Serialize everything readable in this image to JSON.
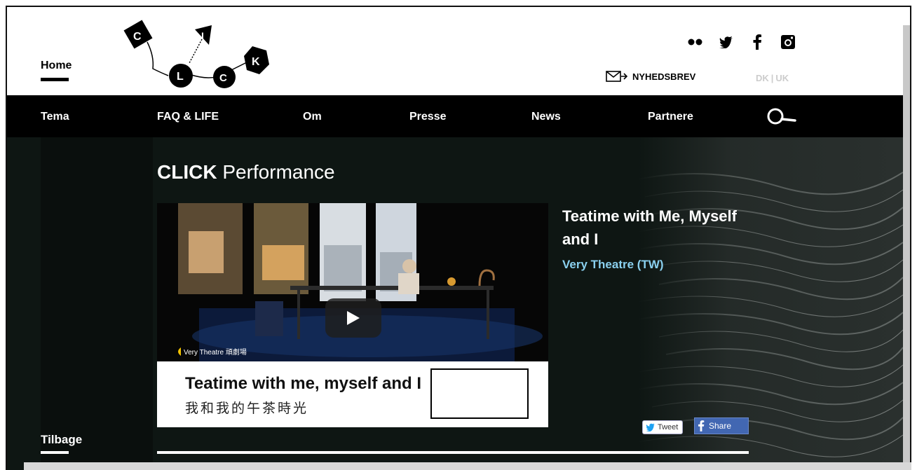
{
  "header": {
    "home_label": "Home",
    "logo_letters": [
      "C",
      "L",
      "I",
      "C",
      "K"
    ],
    "social_icons": [
      "flickr-icon",
      "twitter-icon",
      "facebook-icon",
      "instagram-icon"
    ],
    "newsletter_label": "NYHEDSBREV",
    "lang_dk": "DK",
    "lang_sep": "|",
    "lang_uk": "UK"
  },
  "nav": {
    "items": [
      {
        "label": "Tema",
        "name": "nav-item-tema"
      },
      {
        "label": "FAQ & LIFE",
        "name": "nav-item-faq-life"
      },
      {
        "label": "Om",
        "name": "nav-item-om"
      },
      {
        "label": "Presse",
        "name": "nav-item-presse"
      },
      {
        "label": "News",
        "name": "nav-item-news"
      },
      {
        "label": "Partnere",
        "name": "nav-item-partnere"
      }
    ]
  },
  "main": {
    "section_title_bold": "CLICK",
    "section_title_rest": "Performance",
    "video": {
      "caption_en": "Teatime with me, myself and I",
      "caption_zh": "我和我的午茶時光",
      "brand": "Very Theatre 頑劇場"
    },
    "show_title": "Teatime with Me, Myself and I",
    "show_company": "Very Theatre (TW)",
    "tweet_label": "Tweet",
    "share_label": "Share",
    "back_label": "Tilbage"
  },
  "colors": {
    "nav_bg": "#000000",
    "main_bg": "#0e1613",
    "company_accent": "#8ad0ef",
    "share_bg": "#4267b2"
  }
}
